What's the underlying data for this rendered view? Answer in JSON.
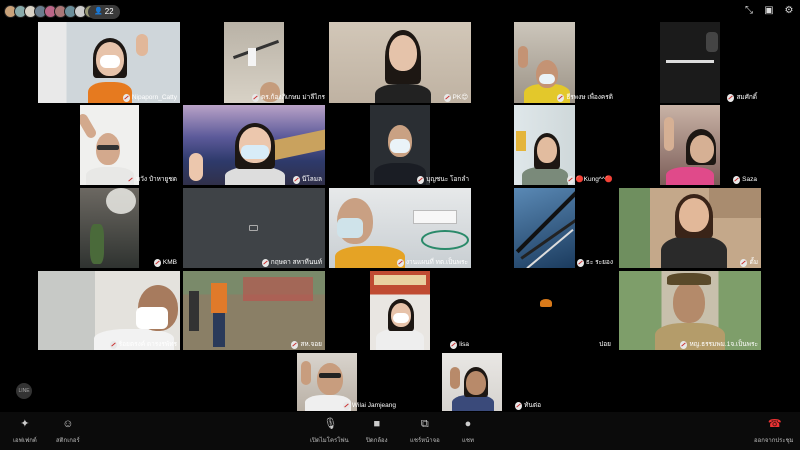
{
  "header": {
    "participant_count": "22",
    "avatar_colors": [
      "#c9a27a",
      "#8aa",
      "#d9d2c5",
      "#6a7d8e",
      "#b68",
      "#a77",
      "#6b8e9a",
      "#ccc",
      "#997"
    ]
  },
  "tiles": [
    {
      "name": "Nipaporn_Catty"
    },
    {
      "name": "ดร.ก้องภิเกษม ม่าลีไกร"
    },
    {
      "name": "PK😊"
    },
    {
      "name": "ธีรพงษ เพื่องครดิ"
    },
    {
      "name": "สมศักดิ์"
    },
    {
      "name": "หวัง ปำหายูชด"
    },
    {
      "name": "นีโลมล"
    },
    {
      "name": "บุญชนะ โอกลำ"
    },
    {
      "name": "🔴Kung^^🔴"
    },
    {
      "name": "Saza"
    },
    {
      "name": "KMB"
    },
    {
      "name": "กฤษดา สหาทีนนท์"
    },
    {
      "name": "งานแผนที่ ทต.เป็นพระ"
    },
    {
      "name": "ธะ ระยอง"
    },
    {
      "name": "ตั้ม"
    },
    {
      "name": "ร้อยตรงค์ ดารงรพัทร"
    },
    {
      "name": "สห.จอย"
    },
    {
      "name": "lisa"
    },
    {
      "name": "ปอย"
    },
    {
      "name": "หญ.ธรรมพม.1จ.เป็นพระ"
    },
    {
      "name": "Wilai Jamjeang"
    },
    {
      "name": "ทันต่อ"
    }
  ],
  "toolbar": {
    "effects": "เอฟเฟกต์",
    "stickers": "สติกเกอร์",
    "unmute": "เปิดไมโครโฟน",
    "camera_off": "ปิดกล้อง",
    "share_screen": "แชร์หน้าจอ",
    "chat": "แชท",
    "leave": "ออกจากประชุม"
  },
  "chat_badge": "LINE"
}
